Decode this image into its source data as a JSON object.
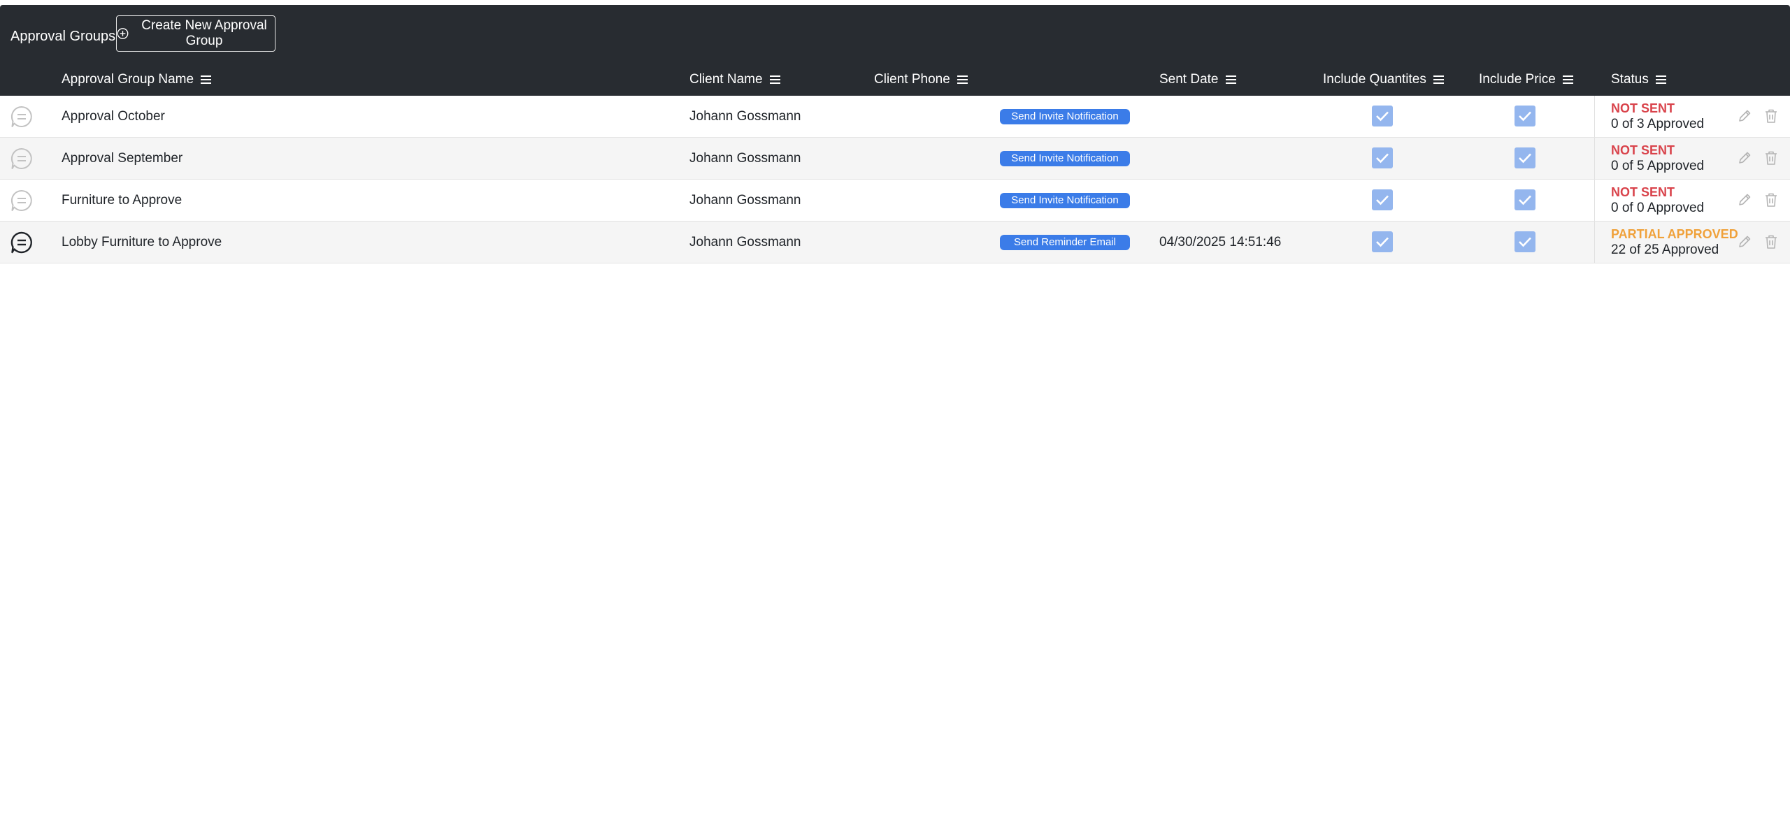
{
  "header": {
    "title": "Approval Groups",
    "create_button": "Create New Approval Group",
    "create_icon": "plus-circle-icon"
  },
  "columns": [
    {
      "key": "name",
      "label": "Approval Group Name"
    },
    {
      "key": "client",
      "label": "Client Name"
    },
    {
      "key": "phone",
      "label": "Client Phone"
    },
    {
      "key": "sent",
      "label": "Sent Date"
    },
    {
      "key": "qty",
      "label": "Include Quantites"
    },
    {
      "key": "price",
      "label": "Include Price"
    },
    {
      "key": "status",
      "label": "Status"
    }
  ],
  "rows": [
    {
      "name": "Approval October",
      "client": "Johann Gossmann",
      "action": "Send Invite Notification",
      "sent_date": "",
      "include_quantities": true,
      "include_price": true,
      "status_label": "NOT SENT",
      "status_count": "0 of 3 Approved",
      "chat_active": false
    },
    {
      "name": "Approval September",
      "client": "Johann Gossmann",
      "action": "Send Invite Notification",
      "sent_date": "",
      "include_quantities": true,
      "include_price": true,
      "status_label": "NOT SENT",
      "status_count": "0 of 5 Approved",
      "chat_active": false
    },
    {
      "name": "Furniture to Approve",
      "client": "Johann Gossmann",
      "action": "Send Invite Notification",
      "sent_date": "",
      "include_quantities": true,
      "include_price": true,
      "status_label": "NOT SENT",
      "status_count": "0 of 0 Approved",
      "chat_active": false
    },
    {
      "name": "Lobby Furniture to Approve",
      "client": "Johann Gossmann",
      "action": "Send Reminder Email",
      "sent_date": "04/30/2025 14:51:46",
      "include_quantities": true,
      "include_price": true,
      "status_label": "PARTIAL APPROVED",
      "status_count": "22 of 25 Approved",
      "chat_active": true
    }
  ],
  "colors": {
    "header_bg": "#282c31",
    "action_button": "#3b7ce8",
    "checkbox": "#94b6ee",
    "not_sent": "#d9434b",
    "partial_approved": "#f0a13a",
    "chat_inactive": "#c2c2c2",
    "chat_active": "#1f2328"
  },
  "icons": {
    "column_menu": "menu-icon",
    "chat": "chat-bubble-icon",
    "check": "checkmark-icon",
    "edit": "pencil-icon",
    "delete": "trash-icon"
  }
}
